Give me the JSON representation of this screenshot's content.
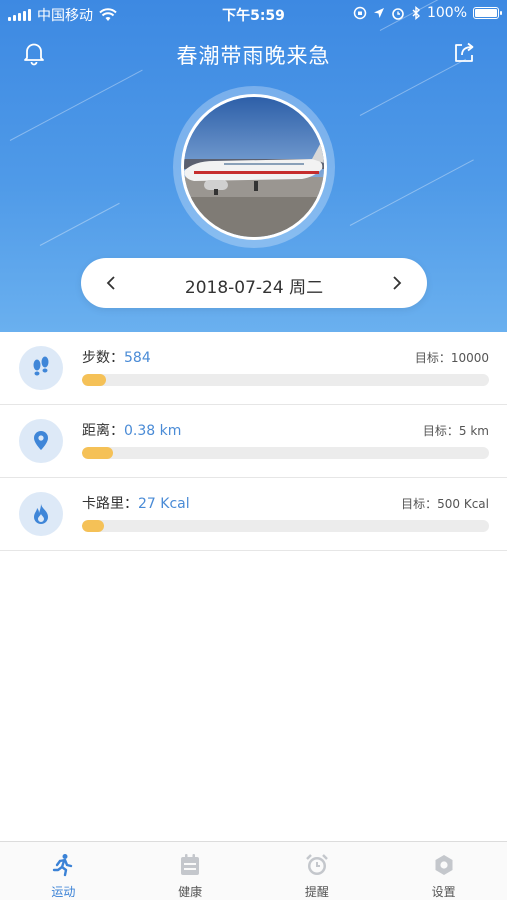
{
  "status_bar": {
    "carrier": "中国移动",
    "time": "下午5:59",
    "battery": "100%"
  },
  "header": {
    "title": "春潮带雨晚来急"
  },
  "date_selector": {
    "date": "2018-07-24 周二"
  },
  "stats": [
    {
      "label": "步数：",
      "value": "584",
      "goal": "目标：10000",
      "progress": 0.058,
      "icon": "footprints-icon"
    },
    {
      "label": "距离：",
      "value": "0.38 km",
      "goal": "目标：5 km",
      "progress": 0.076,
      "icon": "location-pin-icon"
    },
    {
      "label": "卡路里：",
      "value": "27 Kcal",
      "goal": "目标：500 Kcal",
      "progress": 0.054,
      "icon": "flame-icon"
    }
  ],
  "tabs": [
    {
      "label": "运动",
      "active": true,
      "icon": "running-icon"
    },
    {
      "label": "健康",
      "active": false,
      "icon": "calendar-icon"
    },
    {
      "label": "提醒",
      "active": false,
      "icon": "alarm-clock-icon"
    },
    {
      "label": "设置",
      "active": false,
      "icon": "settings-icon"
    }
  ],
  "colors": {
    "header_blue": "#3d89e2",
    "accent_blue": "#4a8bd6",
    "progress_yellow": "#f5c157",
    "active_tab": "#3b82d6",
    "inactive_tab_icon": "#c4c7cc"
  }
}
